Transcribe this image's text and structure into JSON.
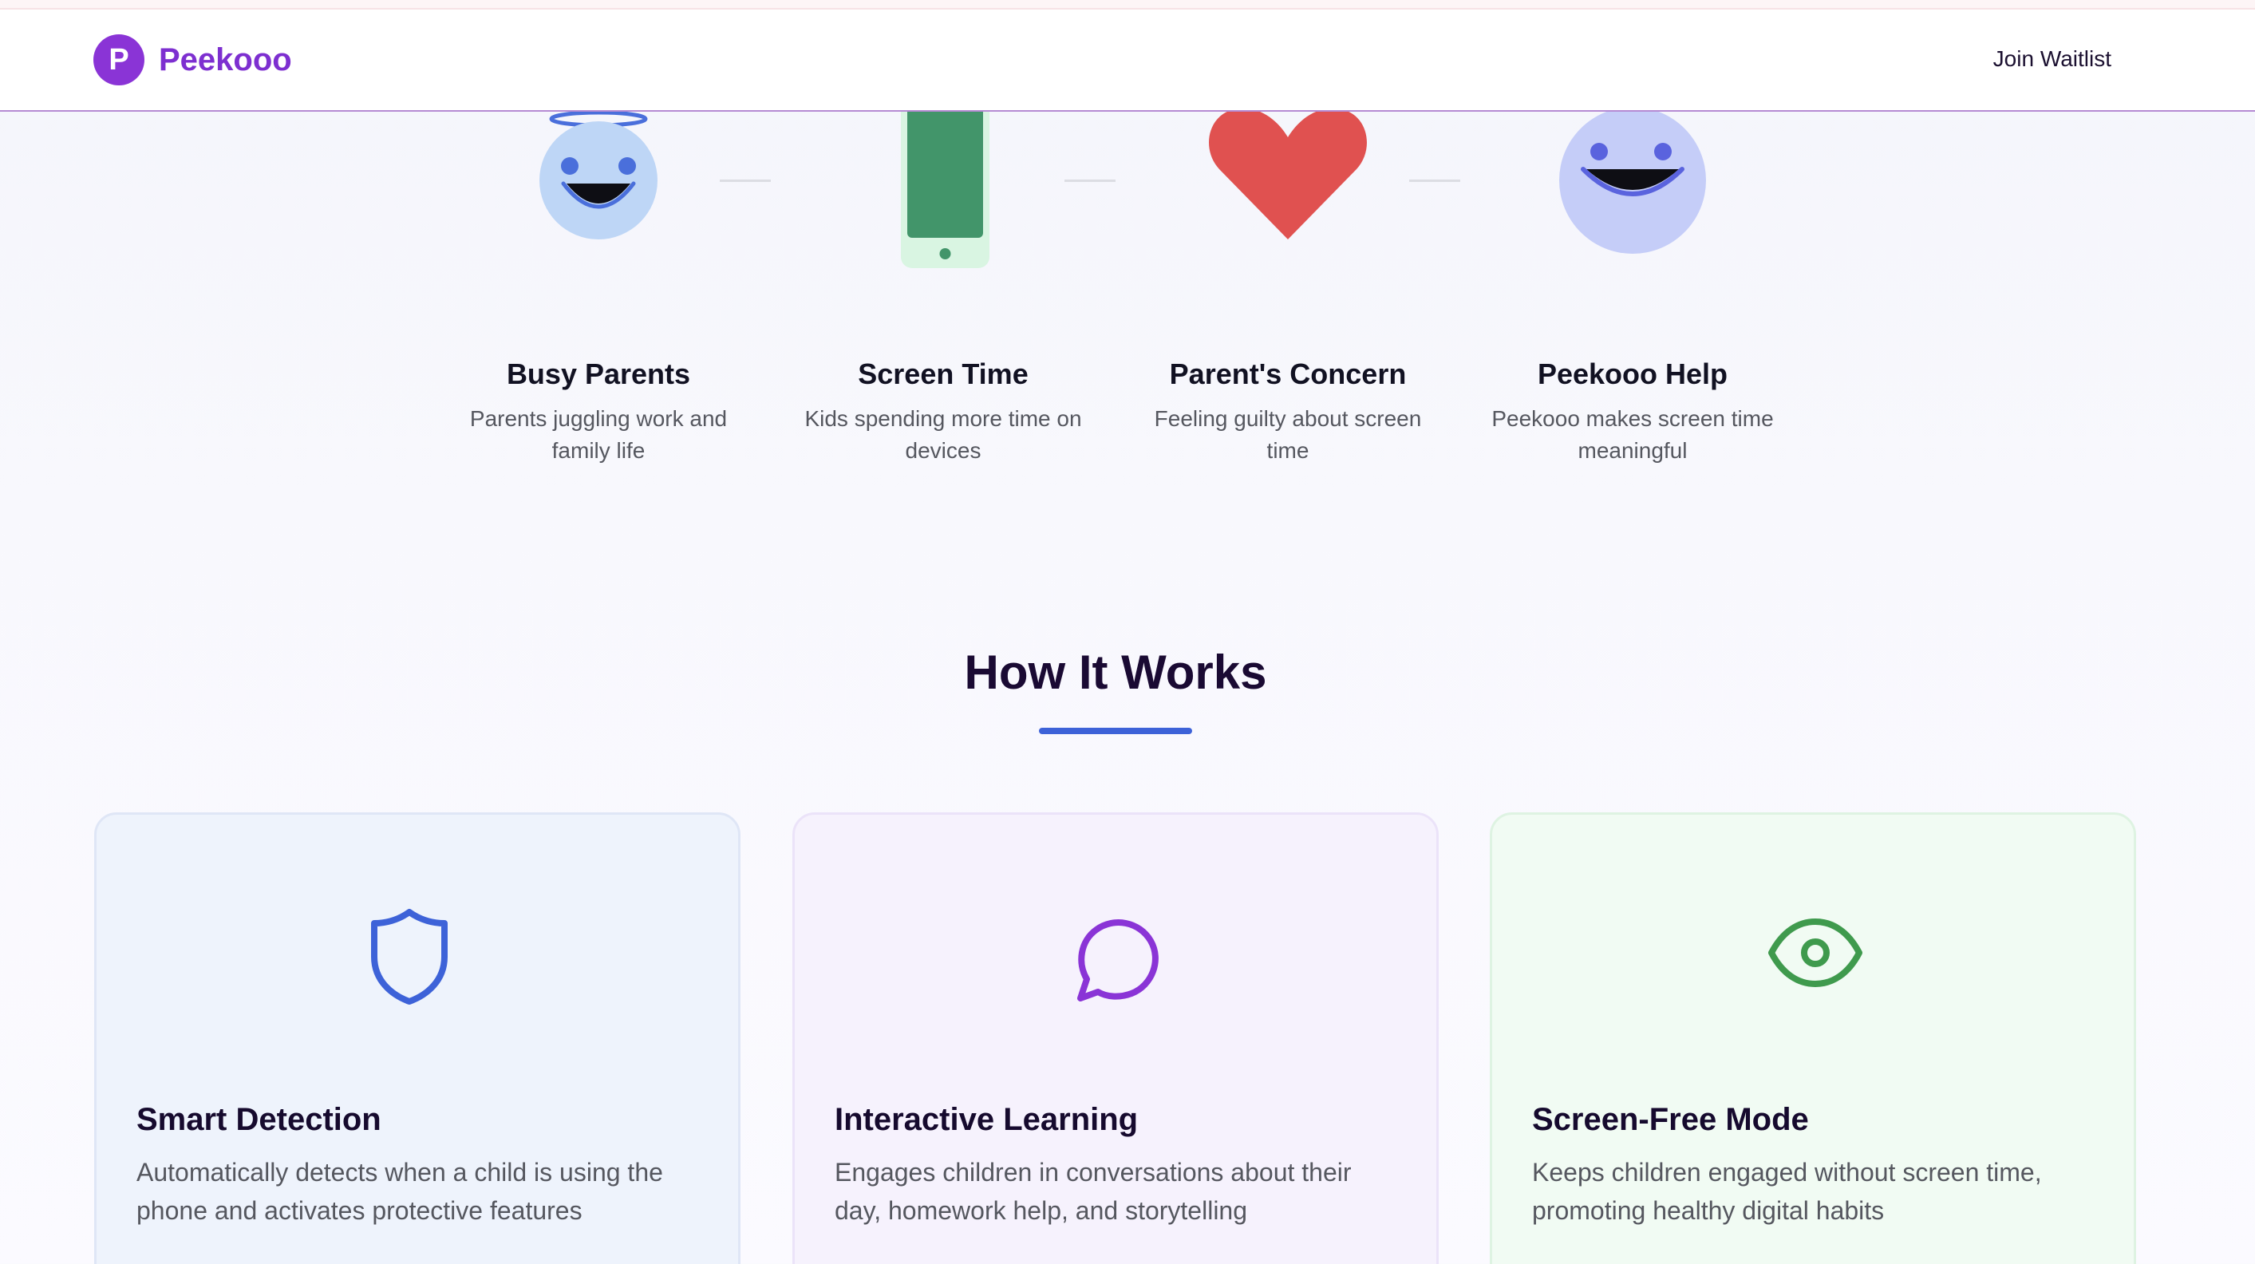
{
  "colors": {
    "brand": "#8a34d6",
    "accent_blue": "#3d62d8",
    "accent_purple": "#8a34d6",
    "accent_green": "#3f9a4d",
    "heart": "#e05150",
    "phone": "#42956a"
  },
  "header": {
    "logo_letter": "P",
    "brand_name": "Peekooo",
    "nav_link": "Join Waitlist"
  },
  "journey": {
    "steps": [
      {
        "icon": "smiling-face-with-halo-icon",
        "title": "Busy Parents",
        "description_line1": "Parents juggling work and",
        "description_line2": "family life"
      },
      {
        "icon": "mobile-phone-icon",
        "title": "Screen Time",
        "description_line1": "Kids spending more time on",
        "description_line2": "devices"
      },
      {
        "icon": "heart-icon",
        "title": "Parent's Concern",
        "description_line1": "Feeling guilty about screen",
        "description_line2": "time"
      },
      {
        "icon": "grinning-face-icon",
        "title": "Peekooo Help",
        "description_line1": "Peekooo makes screen time",
        "description_line2": "meaningful"
      }
    ]
  },
  "how_it_works": {
    "title": "How It Works",
    "cards": [
      {
        "icon": "shield-icon",
        "title": "Smart Detection",
        "description_line1": "Automatically detects when a child is using the",
        "description_line2": "phone and activates protective features"
      },
      {
        "icon": "chat-bubble-icon",
        "title": "Interactive Learning",
        "description_line1": "Engages children in conversations about their",
        "description_line2": "day, homework help, and storytelling"
      },
      {
        "icon": "eye-icon",
        "title": "Screen-Free Mode",
        "description_line1": "Keeps children engaged without screen time,",
        "description_line2": "promoting healthy digital habits"
      }
    ]
  }
}
